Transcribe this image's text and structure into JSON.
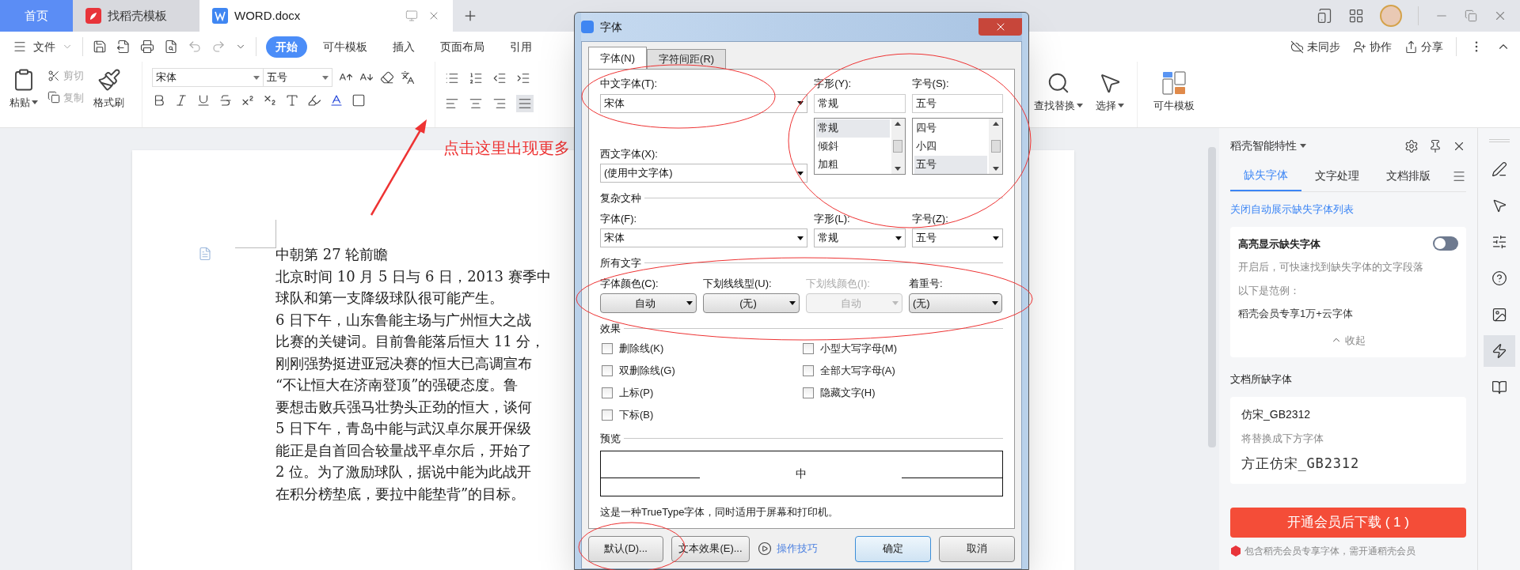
{
  "tabs": [
    {
      "label": "首页",
      "kind": "home",
      "selected": false
    },
    {
      "label": "找稻壳模板",
      "kind": "docer",
      "selected": false
    },
    {
      "label": "WORD.docx",
      "kind": "doc",
      "selected": true
    }
  ],
  "menu": {
    "file": "文件",
    "ribbon_tabs": [
      {
        "label": "开始",
        "selected": true
      },
      {
        "label": "可牛模板",
        "selected": false
      },
      {
        "label": "插入",
        "selected": false
      },
      {
        "label": "页面布局",
        "selected": false
      },
      {
        "label": "引用",
        "selected": false
      }
    ],
    "actions": [
      {
        "label": "未同步",
        "kind": "cloud"
      },
      {
        "label": "协作",
        "kind": "user"
      },
      {
        "label": "分享",
        "kind": "share"
      }
    ]
  },
  "ribbon": {
    "paste": "粘贴",
    "cut": {
      "label": "剪切",
      "disabled": true
    },
    "copy": {
      "label": "复制",
      "disabled": true
    },
    "format_painter": "格式刷",
    "font": "宋体",
    "size": "五号",
    "find_replace": "查找替换",
    "select": "选择",
    "templates": "可牛模板"
  },
  "annotation": "点击这里出现更多",
  "document": {
    "lines": [
      "中朝第 27 轮前瞻",
      "北京时间 10 月 5 日与 6 日，2013 赛季中",
      "球队和第一支降级球队很可能产生。",
      "6 日下午，山东鲁能主场与广州恒大之战",
      "比赛的关键词。目前鲁能落后恒大 11 分，",
      "刚刚强势挺进亚冠决赛的恒大已高调宣布",
      "“不让恒大在济南登顶”的强硬态度。鲁",
      "要想击败兵强马壮势头正劲的恒大，谈何",
      "5 日下午，青岛中能与武汉卓尔展开保级",
      "能正是自首回合较量战平卓尔后，开始了",
      "2 位。为了激励球队，据说中能为此战开",
      "在积分榜垫底，要拉中能垫背”的目标。"
    ]
  },
  "dialog": {
    "title": "字体",
    "tabs": [
      {
        "label": "字体(N)",
        "selected": true
      },
      {
        "label": "字符间距(R)",
        "selected": false
      }
    ],
    "chinese_font": {
      "label": "中文字体(T):",
      "value": "宋体"
    },
    "style": {
      "label": "字形(Y):",
      "value": "常规",
      "options": [
        {
          "label": "常规",
          "selected": true
        },
        {
          "label": "倾斜",
          "selected": false
        },
        {
          "label": "加粗",
          "selected": false
        }
      ]
    },
    "size": {
      "label": "字号(S):",
      "value": "五号",
      "options": [
        {
          "label": "四号",
          "selected": false
        },
        {
          "label": "小四",
          "selected": false
        },
        {
          "label": "五号",
          "selected": true
        }
      ]
    },
    "western_font": {
      "label": "西文字体(X):",
      "value": "(使用中文字体)"
    },
    "complex_section": "复杂文种",
    "complex": [
      {
        "label": "字体(F):",
        "value": "宋体"
      },
      {
        "label": "字形(L):",
        "value": "常规"
      },
      {
        "label": "字号(Z):",
        "value": "五号"
      }
    ],
    "all_text_section": "所有文字",
    "all_text": [
      {
        "label": "字体颜色(C):",
        "value": "自动",
        "disabled": false
      },
      {
        "label": "下划线线型(U):",
        "value": "(无)",
        "disabled": false
      },
      {
        "label": "下划线颜色(I):",
        "value": "自动",
        "disabled": true
      },
      {
        "label": "着重号:",
        "value": "(无)",
        "disabled": false
      }
    ],
    "effects_section": "效果",
    "effects": [
      {
        "label": "删除线(K)",
        "checked": false
      },
      {
        "label": "双删除线(G)",
        "checked": false
      },
      {
        "label": "上标(P)",
        "checked": false
      },
      {
        "label": "下标(B)",
        "checked": false
      },
      {
        "label": "小型大写字母(M)",
        "checked": false
      },
      {
        "label": "全部大写字母(A)",
        "checked": false
      },
      {
        "label": "隐藏文字(H)",
        "checked": false
      }
    ],
    "preview_section": "预览",
    "preview_text": "中",
    "note": "这是一种TrueType字体，同时适用于屏幕和打印机。",
    "buttons": {
      "default": "默认(D)...",
      "text_effects": "文本效果(E)...",
      "tips": "操作技巧",
      "ok": "确定",
      "cancel": "取消"
    }
  },
  "panel": {
    "title": "稻壳智能特性",
    "tabs": [
      {
        "label": "缺失字体",
        "selected": true
      },
      {
        "label": "文字处理",
        "selected": false
      },
      {
        "label": "文档排版",
        "selected": false
      }
    ],
    "link": "关闭自动展示缺失字体列表",
    "highlight": {
      "title": "高亮显示缺失字体",
      "on": false,
      "description": "开启后，可快速找到缺失字体的文字段落",
      "example_label": "以下是范例：",
      "example": "稻壳会员专享1万+云字体",
      "collapse": "收起"
    },
    "missing_heading": "文档所缺字体",
    "missing": {
      "font": "仿宋_GB2312",
      "hint": "将替换成下方字体",
      "replacement": "方正仿宋_GB2312"
    },
    "download": "开通会员后下载 ( 1 )",
    "footer": "包含稻壳会员专享字体，需开通稻壳会员"
  },
  "side_tools": [
    {
      "kind": "pen",
      "selected": false
    },
    {
      "kind": "cursor",
      "selected": false
    },
    {
      "kind": "sliders",
      "selected": false
    },
    {
      "kind": "help",
      "selected": false
    },
    {
      "kind": "image",
      "selected": false
    },
    {
      "kind": "bolt",
      "selected": true
    },
    {
      "kind": "book",
      "selected": false
    }
  ]
}
